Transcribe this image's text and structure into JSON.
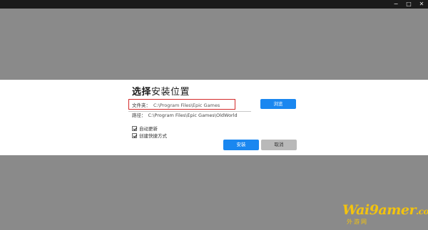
{
  "window": {
    "minimize_glyph": "−",
    "maximize_glyph": "□",
    "close_glyph": "✕"
  },
  "dialog": {
    "title_bold": "选择",
    "title_rest": "安装位置",
    "folder_label": "文件夹：",
    "folder_value": "C:\\Program Files\\Epic Games",
    "browse_label": "浏览",
    "path_label": "路径：",
    "path_value": "C:\\Program Files\\Epic Games\\OldWorld",
    "checkboxes": [
      {
        "label": "自动更新",
        "checked": true
      },
      {
        "label": "创建快捷方式",
        "checked": true
      }
    ],
    "install_label": "安装",
    "cancel_label": "取消"
  },
  "watermark": {
    "main": "Wai9amer",
    "suffix": ".com",
    "sub": "外游网"
  },
  "colors": {
    "accent": "#1a87f0",
    "highlight_box": "#d32a2a",
    "watermark": "#f3c30e"
  }
}
